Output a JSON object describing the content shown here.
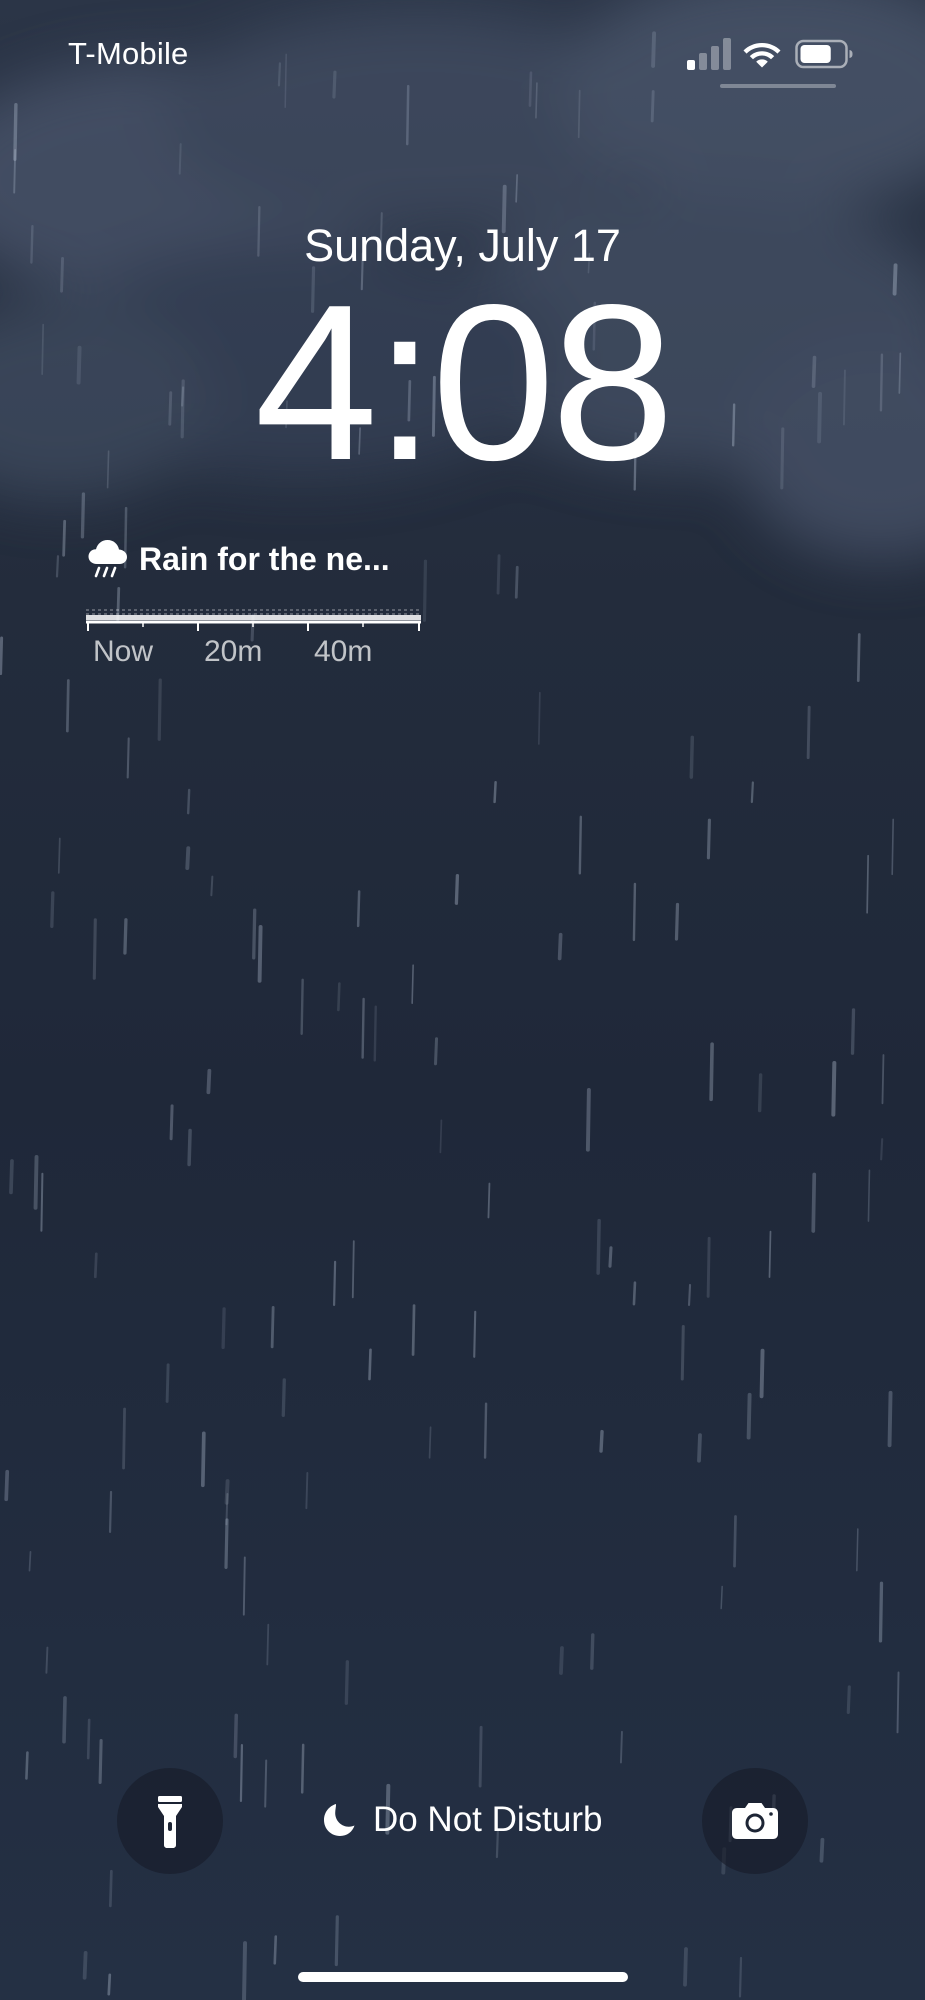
{
  "status_bar": {
    "carrier": "T-Mobile",
    "signal_bars_active": 1,
    "signal_bars_total": 4,
    "battery_level": 0.72
  },
  "lock_screen": {
    "date": "Sunday, July 17",
    "time": "4:08"
  },
  "weather_widget": {
    "icon": "rain-cloud-icon",
    "title": "Rain for the ne...",
    "chart_labels": [
      "Now",
      "20m",
      "40m"
    ]
  },
  "bottom_bar": {
    "flashlight_icon": "flashlight-icon",
    "camera_icon": "camera-icon",
    "focus_icon": "moon-icon",
    "focus_label": "Do Not Disturb"
  },
  "colors": {
    "background_top": "#2b3547",
    "background_bottom": "#243044",
    "text": "#ffffff"
  }
}
